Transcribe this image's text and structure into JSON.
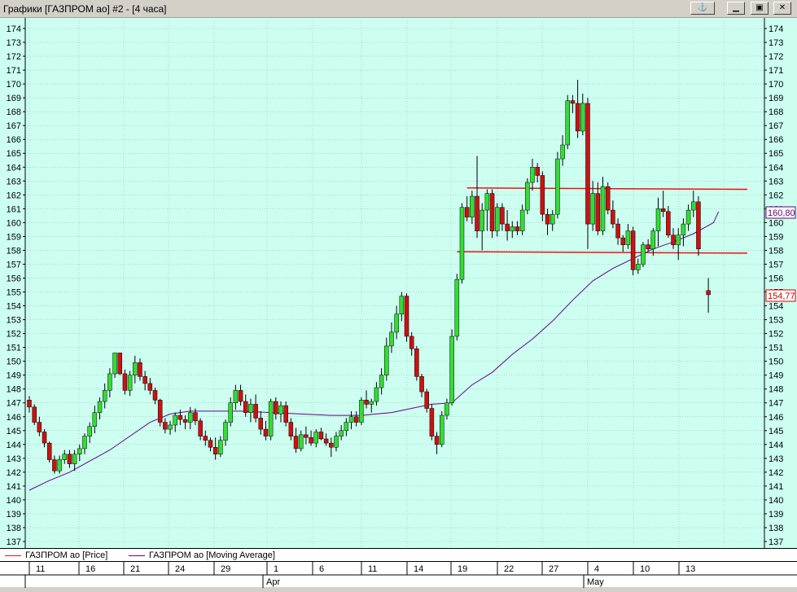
{
  "window": {
    "title": "Графики [ГАЗПРОМ ао] #2 - [4 часа]",
    "anchor_icon": "anchor-icon",
    "minimize_icon": "minimize-icon",
    "maximize_icon": "maximize-icon",
    "close_icon": "close-icon"
  },
  "colors": {
    "background": "#ccfff0",
    "grid": "#9aaaa6",
    "bull_candle": "#33dd33",
    "bear_candle": "#cc1111",
    "moving_average": "#660088",
    "level_lines": "#ee1111",
    "last_price_label": "#cc0000"
  },
  "price_axis": {
    "min": 137,
    "max": 174,
    "labels": [
      "174",
      "173",
      "172",
      "171",
      "170",
      "169",
      "168",
      "167",
      "166",
      "165",
      "164",
      "163",
      "162",
      "161",
      "160",
      "159",
      "158",
      "157",
      "156",
      "155",
      "154",
      "153",
      "152",
      "151",
      "150",
      "149",
      "148",
      "147",
      "146",
      "145",
      "144",
      "143",
      "142",
      "141",
      "140",
      "139",
      "138",
      "137"
    ]
  },
  "price_labels": {
    "ma_value": "160,80",
    "last_price": "154,77"
  },
  "legend": {
    "price_label": "ГАЗПРОМ ао [Price]",
    "ma_label": "ГАЗПРОМ ао [Moving Average]"
  },
  "date_axis": {
    "day_labels": [
      "11",
      "16",
      "21",
      "24",
      "29",
      "1",
      "6",
      "11",
      "14",
      "19",
      "22",
      "27",
      "4",
      "10",
      "13"
    ],
    "month_labels": [
      "Apr",
      "May"
    ]
  },
  "chart_data": {
    "type": "candlestick",
    "instrument": "ГАЗПРОМ ао",
    "timeframe": "4 часа",
    "ylim": [
      137,
      174
    ],
    "grid": true,
    "candles": [
      {
        "o": 147.2,
        "h": 147.5,
        "l": 146.3,
        "c": 146.7
      },
      {
        "o": 146.7,
        "h": 146.9,
        "l": 145.4,
        "c": 145.6
      },
      {
        "o": 145.6,
        "h": 146.0,
        "l": 144.6,
        "c": 144.9
      },
      {
        "o": 144.9,
        "h": 145.1,
        "l": 143.8,
        "c": 144.1
      },
      {
        "o": 144.1,
        "h": 144.2,
        "l": 142.7,
        "c": 142.9
      },
      {
        "o": 142.9,
        "h": 143.2,
        "l": 141.9,
        "c": 142.1
      },
      {
        "o": 142.1,
        "h": 143.2,
        "l": 141.9,
        "c": 142.9
      },
      {
        "o": 142.9,
        "h": 143.6,
        "l": 142.6,
        "c": 143.3
      },
      {
        "o": 143.3,
        "h": 143.6,
        "l": 142.3,
        "c": 142.6
      },
      {
        "o": 142.6,
        "h": 143.6,
        "l": 142.1,
        "c": 143.3
      },
      {
        "o": 143.3,
        "h": 144.0,
        "l": 142.8,
        "c": 143.7
      },
      {
        "o": 143.7,
        "h": 144.8,
        "l": 143.3,
        "c": 144.6
      },
      {
        "o": 144.6,
        "h": 145.6,
        "l": 144.1,
        "c": 145.3
      },
      {
        "o": 145.3,
        "h": 146.8,
        "l": 144.8,
        "c": 146.3
      },
      {
        "o": 146.3,
        "h": 147.4,
        "l": 145.8,
        "c": 147.1
      },
      {
        "o": 147.1,
        "h": 148.4,
        "l": 146.6,
        "c": 147.9
      },
      {
        "o": 147.9,
        "h": 149.5,
        "l": 147.4,
        "c": 149.1
      },
      {
        "o": 149.1,
        "h": 150.6,
        "l": 148.8,
        "c": 150.6
      },
      {
        "o": 150.6,
        "h": 150.6,
        "l": 149.0,
        "c": 149.1
      },
      {
        "o": 149.1,
        "h": 149.4,
        "l": 147.6,
        "c": 147.9
      },
      {
        "o": 147.9,
        "h": 149.3,
        "l": 147.5,
        "c": 149.0
      },
      {
        "o": 149.0,
        "h": 150.4,
        "l": 148.4,
        "c": 149.9
      },
      {
        "o": 149.9,
        "h": 150.2,
        "l": 148.6,
        "c": 148.9
      },
      {
        "o": 148.9,
        "h": 149.3,
        "l": 147.9,
        "c": 148.4
      },
      {
        "o": 148.4,
        "h": 148.8,
        "l": 147.6,
        "c": 147.9
      },
      {
        "o": 147.9,
        "h": 148.1,
        "l": 146.9,
        "c": 147.2
      },
      {
        "o": 147.2,
        "h": 147.3,
        "l": 145.3,
        "c": 145.6
      },
      {
        "o": 145.6,
        "h": 145.9,
        "l": 144.8,
        "c": 145.1
      },
      {
        "o": 145.1,
        "h": 145.7,
        "l": 144.7,
        "c": 145.4
      },
      {
        "o": 145.4,
        "h": 146.3,
        "l": 144.9,
        "c": 146.1
      },
      {
        "o": 146.1,
        "h": 146.5,
        "l": 145.4,
        "c": 145.8
      },
      {
        "o": 145.8,
        "h": 146.1,
        "l": 145.1,
        "c": 145.6
      },
      {
        "o": 145.6,
        "h": 146.7,
        "l": 145.1,
        "c": 146.3
      },
      {
        "o": 146.3,
        "h": 146.6,
        "l": 145.4,
        "c": 145.7
      },
      {
        "o": 145.7,
        "h": 145.9,
        "l": 144.3,
        "c": 144.6
      },
      {
        "o": 144.6,
        "h": 145.0,
        "l": 143.9,
        "c": 144.3
      },
      {
        "o": 144.3,
        "h": 144.5,
        "l": 143.5,
        "c": 143.8
      },
      {
        "o": 143.8,
        "h": 144.5,
        "l": 142.9,
        "c": 143.3
      },
      {
        "o": 143.3,
        "h": 144.6,
        "l": 143.1,
        "c": 144.3
      },
      {
        "o": 144.3,
        "h": 145.8,
        "l": 143.9,
        "c": 145.6
      },
      {
        "o": 145.6,
        "h": 147.4,
        "l": 145.3,
        "c": 147.0
      },
      {
        "o": 147.0,
        "h": 148.3,
        "l": 146.5,
        "c": 147.9
      },
      {
        "o": 147.9,
        "h": 148.3,
        "l": 146.8,
        "c": 147.1
      },
      {
        "o": 147.1,
        "h": 147.6,
        "l": 146.0,
        "c": 146.3
      },
      {
        "o": 146.3,
        "h": 147.3,
        "l": 145.6,
        "c": 146.9
      },
      {
        "o": 146.9,
        "h": 147.6,
        "l": 145.6,
        "c": 145.9
      },
      {
        "o": 145.9,
        "h": 146.4,
        "l": 144.7,
        "c": 145.1
      },
      {
        "o": 145.1,
        "h": 145.7,
        "l": 144.3,
        "c": 144.6
      },
      {
        "o": 144.6,
        "h": 147.3,
        "l": 144.3,
        "c": 147.1
      },
      {
        "o": 147.1,
        "h": 147.4,
        "l": 145.8,
        "c": 146.2
      },
      {
        "o": 146.2,
        "h": 147.1,
        "l": 145.6,
        "c": 146.8
      },
      {
        "o": 146.8,
        "h": 147.1,
        "l": 145.3,
        "c": 145.6
      },
      {
        "o": 145.6,
        "h": 145.9,
        "l": 144.3,
        "c": 144.6
      },
      {
        "o": 144.6,
        "h": 145.2,
        "l": 143.4,
        "c": 143.7
      },
      {
        "o": 143.7,
        "h": 145.0,
        "l": 143.5,
        "c": 144.7
      },
      {
        "o": 144.7,
        "h": 145.3,
        "l": 144.0,
        "c": 144.5
      },
      {
        "o": 144.5,
        "h": 145.0,
        "l": 143.9,
        "c": 144.1
      },
      {
        "o": 144.1,
        "h": 145.1,
        "l": 143.8,
        "c": 144.9
      },
      {
        "o": 144.9,
        "h": 145.2,
        "l": 144.3,
        "c": 144.4
      },
      {
        "o": 144.4,
        "h": 144.8,
        "l": 143.9,
        "c": 144.1
      },
      {
        "o": 144.1,
        "h": 144.5,
        "l": 143.1,
        "c": 143.8
      },
      {
        "o": 143.8,
        "h": 144.9,
        "l": 143.5,
        "c": 144.6
      },
      {
        "o": 144.6,
        "h": 145.4,
        "l": 144.3,
        "c": 145.0
      },
      {
        "o": 145.0,
        "h": 145.9,
        "l": 144.6,
        "c": 145.6
      },
      {
        "o": 145.6,
        "h": 146.4,
        "l": 145.1,
        "c": 146.0
      },
      {
        "o": 146.0,
        "h": 146.4,
        "l": 145.3,
        "c": 145.6
      },
      {
        "o": 145.6,
        "h": 147.4,
        "l": 145.4,
        "c": 147.2
      },
      {
        "o": 147.2,
        "h": 147.9,
        "l": 146.6,
        "c": 146.9
      },
      {
        "o": 146.9,
        "h": 147.3,
        "l": 146.3,
        "c": 147.1
      },
      {
        "o": 147.1,
        "h": 148.5,
        "l": 146.8,
        "c": 148.1
      },
      {
        "o": 148.1,
        "h": 149.5,
        "l": 147.6,
        "c": 149.0
      },
      {
        "o": 149.0,
        "h": 151.7,
        "l": 148.6,
        "c": 151.1
      },
      {
        "o": 151.1,
        "h": 152.8,
        "l": 150.6,
        "c": 152.1
      },
      {
        "o": 152.1,
        "h": 154.0,
        "l": 151.6,
        "c": 153.4
      },
      {
        "o": 153.4,
        "h": 155.0,
        "l": 152.9,
        "c": 154.7
      },
      {
        "o": 154.7,
        "h": 154.9,
        "l": 151.4,
        "c": 151.8
      },
      {
        "o": 151.8,
        "h": 152.1,
        "l": 150.4,
        "c": 150.9
      },
      {
        "o": 150.9,
        "h": 151.1,
        "l": 148.6,
        "c": 148.9
      },
      {
        "o": 148.9,
        "h": 149.1,
        "l": 147.4,
        "c": 147.8
      },
      {
        "o": 147.8,
        "h": 148.0,
        "l": 146.3,
        "c": 146.6
      },
      {
        "o": 146.6,
        "h": 146.9,
        "l": 144.3,
        "c": 144.6
      },
      {
        "o": 144.6,
        "h": 144.9,
        "l": 143.3,
        "c": 144.0
      },
      {
        "o": 144.0,
        "h": 146.4,
        "l": 143.8,
        "c": 146.1
      },
      {
        "o": 146.1,
        "h": 147.3,
        "l": 145.8,
        "c": 147.0
      },
      {
        "o": 147.0,
        "h": 152.3,
        "l": 146.8,
        "c": 151.8
      },
      {
        "o": 151.8,
        "h": 156.3,
        "l": 151.5,
        "c": 155.9
      },
      {
        "o": 155.9,
        "h": 161.4,
        "l": 155.6,
        "c": 161.1
      },
      {
        "o": 161.1,
        "h": 161.9,
        "l": 160.1,
        "c": 160.4
      },
      {
        "o": 160.4,
        "h": 162.3,
        "l": 159.9,
        "c": 161.9
      },
      {
        "o": 161.9,
        "h": 164.8,
        "l": 158.9,
        "c": 159.4
      },
      {
        "o": 159.4,
        "h": 161.4,
        "l": 158.0,
        "c": 160.9
      },
      {
        "o": 160.9,
        "h": 162.4,
        "l": 159.4,
        "c": 162.1
      },
      {
        "o": 162.1,
        "h": 162.4,
        "l": 158.9,
        "c": 159.4
      },
      {
        "o": 159.4,
        "h": 161.4,
        "l": 159.0,
        "c": 161.1
      },
      {
        "o": 161.1,
        "h": 161.4,
        "l": 159.4,
        "c": 159.9
      },
      {
        "o": 159.9,
        "h": 160.9,
        "l": 158.7,
        "c": 159.4
      },
      {
        "o": 159.4,
        "h": 160.1,
        "l": 158.9,
        "c": 159.7
      },
      {
        "o": 159.7,
        "h": 160.1,
        "l": 159.1,
        "c": 159.4
      },
      {
        "o": 159.4,
        "h": 161.3,
        "l": 159.1,
        "c": 160.9
      },
      {
        "o": 160.9,
        "h": 163.2,
        "l": 160.6,
        "c": 162.9
      },
      {
        "o": 162.9,
        "h": 164.6,
        "l": 162.3,
        "c": 164.0
      },
      {
        "o": 164.0,
        "h": 164.3,
        "l": 162.9,
        "c": 163.4
      },
      {
        "o": 163.4,
        "h": 163.7,
        "l": 160.1,
        "c": 160.6
      },
      {
        "o": 160.6,
        "h": 161.0,
        "l": 159.1,
        "c": 159.9
      },
      {
        "o": 159.9,
        "h": 160.9,
        "l": 159.4,
        "c": 160.6
      },
      {
        "o": 160.6,
        "h": 165.1,
        "l": 160.3,
        "c": 164.6
      },
      {
        "o": 164.6,
        "h": 166.3,
        "l": 164.1,
        "c": 165.6
      },
      {
        "o": 165.6,
        "h": 169.2,
        "l": 165.3,
        "c": 168.8
      },
      {
        "o": 168.8,
        "h": 169.2,
        "l": 167.9,
        "c": 168.6
      },
      {
        "o": 168.6,
        "h": 170.3,
        "l": 166.1,
        "c": 166.6
      },
      {
        "o": 166.6,
        "h": 169.3,
        "l": 166.3,
        "c": 168.6
      },
      {
        "o": 168.6,
        "h": 169.0,
        "l": 158.1,
        "c": 159.9
      },
      {
        "o": 159.9,
        "h": 163.0,
        "l": 159.4,
        "c": 162.1
      },
      {
        "o": 162.1,
        "h": 162.9,
        "l": 159.1,
        "c": 159.4
      },
      {
        "o": 159.4,
        "h": 163.3,
        "l": 159.1,
        "c": 162.6
      },
      {
        "o": 162.6,
        "h": 162.9,
        "l": 160.6,
        "c": 160.9
      },
      {
        "o": 160.9,
        "h": 161.6,
        "l": 159.6,
        "c": 159.9
      },
      {
        "o": 159.9,
        "h": 160.3,
        "l": 158.4,
        "c": 158.9
      },
      {
        "o": 158.9,
        "h": 159.1,
        "l": 157.9,
        "c": 158.4
      },
      {
        "o": 158.4,
        "h": 159.9,
        "l": 158.1,
        "c": 159.4
      },
      {
        "o": 159.4,
        "h": 159.7,
        "l": 156.2,
        "c": 156.6
      },
      {
        "o": 156.6,
        "h": 157.4,
        "l": 156.3,
        "c": 157.0
      },
      {
        "o": 157.0,
        "h": 158.6,
        "l": 156.8,
        "c": 158.4
      },
      {
        "o": 158.4,
        "h": 158.8,
        "l": 157.9,
        "c": 158.1
      },
      {
        "o": 158.1,
        "h": 159.6,
        "l": 157.6,
        "c": 159.4
      },
      {
        "o": 159.4,
        "h": 161.8,
        "l": 158.3,
        "c": 161.0
      },
      {
        "o": 161.0,
        "h": 162.3,
        "l": 160.4,
        "c": 160.8
      },
      {
        "o": 160.8,
        "h": 161.2,
        "l": 158.9,
        "c": 159.1
      },
      {
        "o": 159.1,
        "h": 159.6,
        "l": 158.1,
        "c": 158.4
      },
      {
        "o": 158.4,
        "h": 159.6,
        "l": 157.3,
        "c": 159.1
      },
      {
        "o": 159.1,
        "h": 160.3,
        "l": 158.3,
        "c": 159.9
      },
      {
        "o": 159.9,
        "h": 161.3,
        "l": 159.4,
        "c": 160.9
      },
      {
        "o": 160.9,
        "h": 162.3,
        "l": 160.4,
        "c": 161.5
      },
      {
        "o": 161.5,
        "h": 161.9,
        "l": 157.6,
        "c": 158.1
      },
      {
        "o": 155.1,
        "h": 156.0,
        "l": 153.5,
        "c": 154.8
      }
    ],
    "moving_average": {
      "name": "ГАЗПРОМ ао [Moving Average]",
      "points": [
        {
          "bar": 0,
          "v": 140.7
        },
        {
          "bar": 4,
          "v": 141.4
        },
        {
          "bar": 8,
          "v": 142.0
        },
        {
          "bar": 12,
          "v": 142.8
        },
        {
          "bar": 16,
          "v": 143.6
        },
        {
          "bar": 20,
          "v": 144.6
        },
        {
          "bar": 24,
          "v": 145.6
        },
        {
          "bar": 28,
          "v": 146.2
        },
        {
          "bar": 32,
          "v": 146.4
        },
        {
          "bar": 36,
          "v": 146.4
        },
        {
          "bar": 42,
          "v": 146.4
        },
        {
          "bar": 48,
          "v": 146.3
        },
        {
          "bar": 54,
          "v": 146.2
        },
        {
          "bar": 60,
          "v": 146.1
        },
        {
          "bar": 66,
          "v": 146.1
        },
        {
          "bar": 72,
          "v": 146.3
        },
        {
          "bar": 76,
          "v": 146.6
        },
        {
          "bar": 80,
          "v": 146.9
        },
        {
          "bar": 84,
          "v": 147.0
        },
        {
          "bar": 88,
          "v": 148.3
        },
        {
          "bar": 92,
          "v": 149.2
        },
        {
          "bar": 96,
          "v": 150.5
        },
        {
          "bar": 100,
          "v": 151.6
        },
        {
          "bar": 104,
          "v": 152.9
        },
        {
          "bar": 108,
          "v": 154.4
        },
        {
          "bar": 112,
          "v": 155.8
        },
        {
          "bar": 116,
          "v": 156.7
        },
        {
          "bar": 120,
          "v": 157.4
        },
        {
          "bar": 124,
          "v": 158.1
        },
        {
          "bar": 128,
          "v": 158.6
        },
        {
          "bar": 132,
          "v": 159.2
        },
        {
          "bar": 136,
          "v": 160.0
        },
        {
          "bar": 137,
          "v": 160.8
        }
      ]
    },
    "horizontal_lines": [
      {
        "from_bar": 87,
        "to_bar": 150,
        "y1": 162.5,
        "y2": 162.4
      },
      {
        "from_bar": 85,
        "to_bar": 150,
        "y1": 157.9,
        "y2": 157.8
      }
    ]
  }
}
